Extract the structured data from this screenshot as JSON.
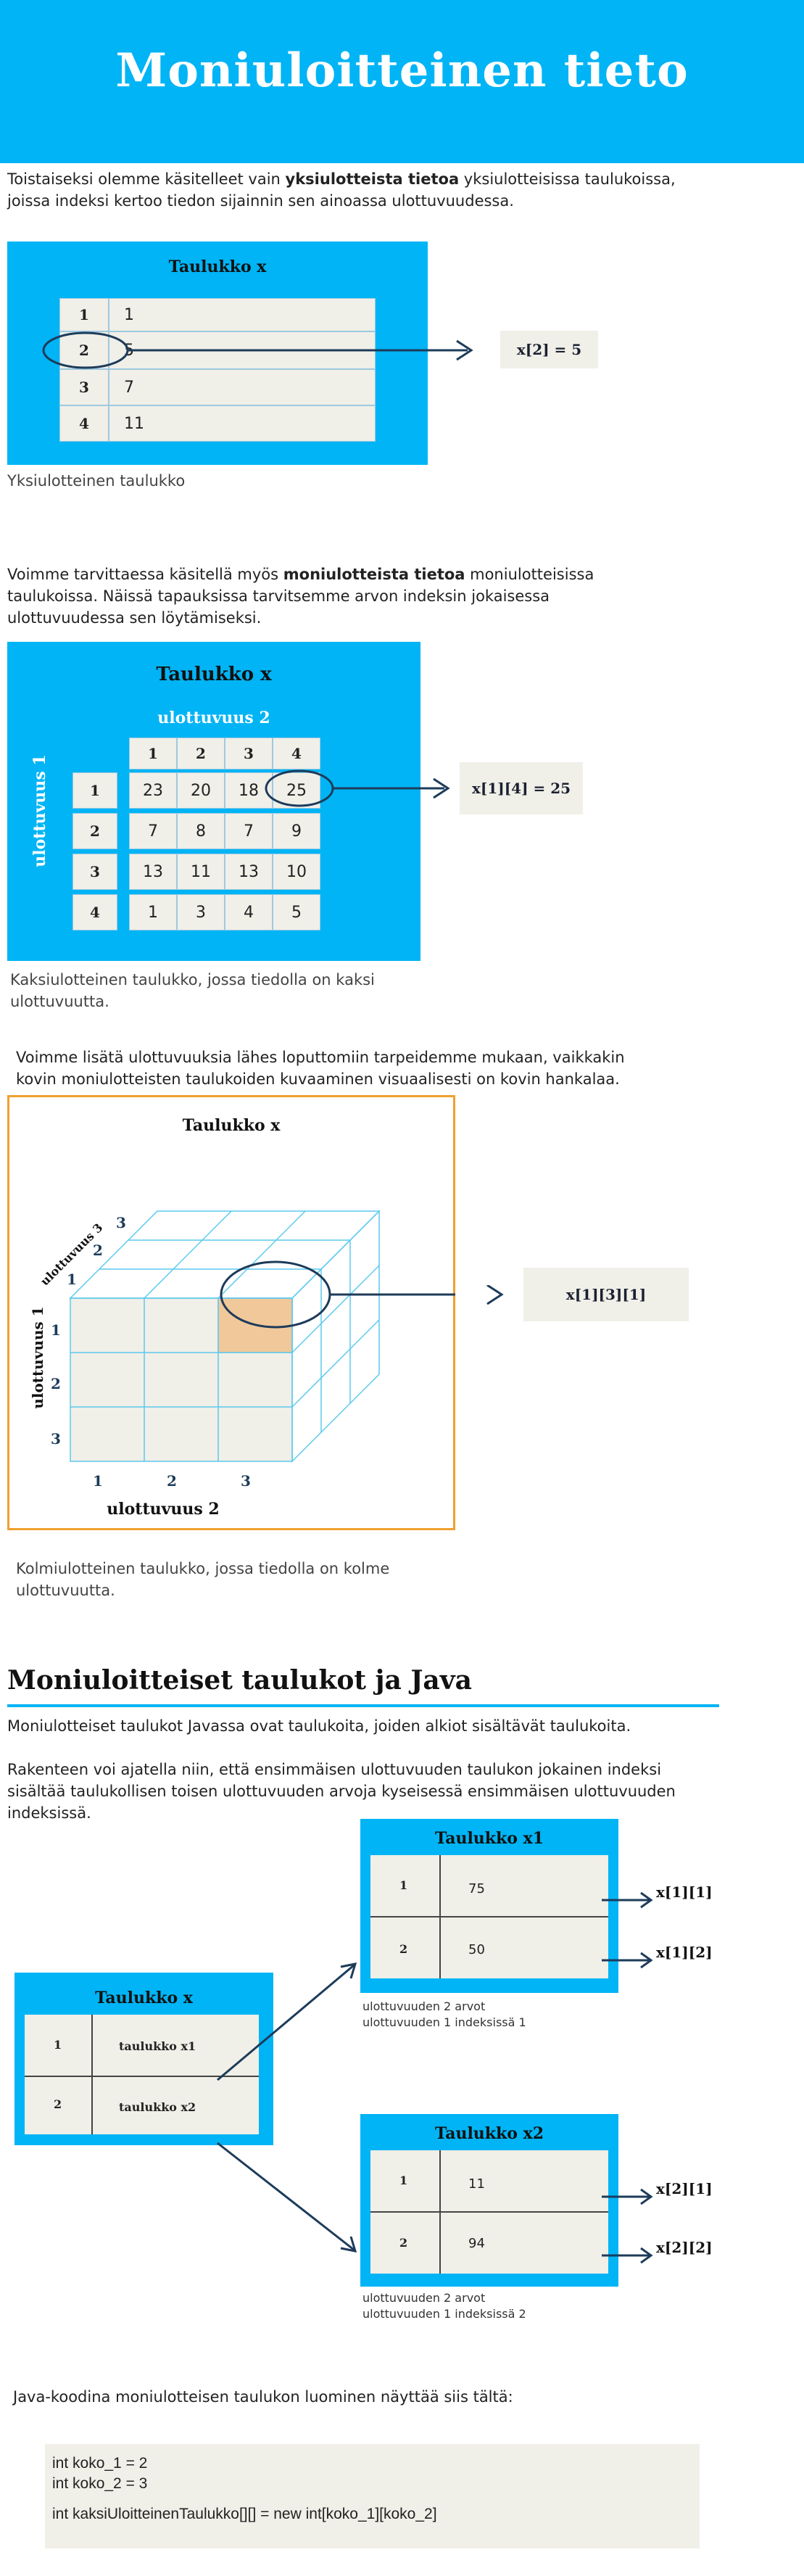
{
  "header": {
    "title": "Moniuloitteinen tieto"
  },
  "intro": {
    "before": "Toistaiseksi olemme käsitelleet vain ",
    "bold": "yksiulotteista tietoa",
    "after": " yksiulotteisissa taulukoissa, joissa indeksi kertoo tiedon sijainnin sen ainoassa ulottuvuudessa."
  },
  "table1": {
    "title": "Taulukko x",
    "rows": [
      {
        "idx": "1",
        "val": "1"
      },
      {
        "idx": "2",
        "val": "5"
      },
      {
        "idx": "3",
        "val": "7"
      },
      {
        "idx": "4",
        "val": "11"
      }
    ],
    "result": "x[2] = 5",
    "caption": "Yksiulotteinen taulukko"
  },
  "para2": {
    "before": "Voimme tarvittaessa käsitellä myös ",
    "bold": "moniulotteista tietoa",
    "after": " moniulotteisissa taulukoissa. Näissä tapauksissa tarvitsemme arvon indeksin jokaisessa ulottuvuudessa sen löytämiseksi."
  },
  "table2": {
    "title": "Taulukko x",
    "dim2_label": "ulottuvuus 2",
    "dim1_label": "ulottuvuus 1",
    "col_headers": [
      "1",
      "2",
      "3",
      "4"
    ],
    "row_headers": [
      "1",
      "2",
      "3",
      "4"
    ],
    "values": [
      [
        "23",
        "20",
        "18",
        "25"
      ],
      [
        "7",
        "8",
        "7",
        "9"
      ],
      [
        "13",
        "11",
        "13",
        "10"
      ],
      [
        "1",
        "3",
        "4",
        "5"
      ]
    ],
    "result": "x[1][4] = 25",
    "caption": "Kaksiulotteinen taulukko, jossa tiedolla on kaksi ulottuvuutta."
  },
  "para3": "Voimme lisätä ulottuvuuksia lähes loputtomiin tarpeidemme mukaan, vaikkakin kovin moniulotteisten taulukoiden kuvaaminen visuaalisesti on kovin hankalaa.",
  "table3": {
    "title": "Taulukko x",
    "dim1_label": "ulottuvuus 1",
    "dim2_label": "ulottuvuus 2",
    "dim3_label": "ulottuvuus 3",
    "dim1_ticks": [
      "1",
      "2",
      "3"
    ],
    "dim2_ticks": [
      "1",
      "2",
      "3"
    ],
    "dim3_ticks": [
      "1",
      "2",
      "3"
    ],
    "result": "x[1][3][1]",
    "caption": "Kolmiulotteinen taulukko, jossa tiedolla on kolme ulottuvuutta.",
    "accent": "#f0a030",
    "highlight": "#f0c89a"
  },
  "section2": {
    "heading": "Moniuloitteiset taulukot ja Java",
    "p1": "Moniulotteiset taulukot Javassa ovat taulukoita, joiden alkiot sisältävät taulukoita.",
    "p2": "Rakenteen voi ajatella niin, että ensimmäisen ulottuvuuden taulukon jokainen indeksi sisältää taulukollisen toisen ulottuvuuden arvoja kyseisessä ensimmäisen ulottuvuuden indeksissä."
  },
  "java_diagram": {
    "main": {
      "title": "Taulukko x",
      "rows": [
        {
          "idx": "1",
          "val": "taulukko x1"
        },
        {
          "idx": "2",
          "val": "taulukko x2"
        }
      ]
    },
    "sub1": {
      "title": "Taulukko x1",
      "rows": [
        {
          "idx": "1",
          "val": "75",
          "ref": "x[1][1]"
        },
        {
          "idx": "2",
          "val": "50",
          "ref": "x[1][2]"
        }
      ],
      "note1": "ulottuvuuden 2 arvot",
      "note2": "ulottuvuuden 1 indeksissä 1"
    },
    "sub2": {
      "title": "Taulukko x2",
      "rows": [
        {
          "idx": "1",
          "val": "11",
          "ref": "x[2][1]"
        },
        {
          "idx": "2",
          "val": "94",
          "ref": "x[2][2]"
        }
      ],
      "note1": "ulottuvuuden 2 arvot",
      "note2": "ulottuvuuden 1 indeksissä 2"
    }
  },
  "code_intro": "Java-koodina moniulotteisen taulukon luominen näyttää siis tältä:",
  "code_lines": [
    "int koko_1 = 2",
    "int koko_2 = 3",
    "int kaksiUloitteinenTaulukko[][] = new int[koko_1][koko_2]"
  ],
  "colors": {
    "brand": "#00b4f5",
    "card": "#f0efe8",
    "arrow": "#1d3b5a",
    "ink_blue": "#1d3b5a"
  }
}
